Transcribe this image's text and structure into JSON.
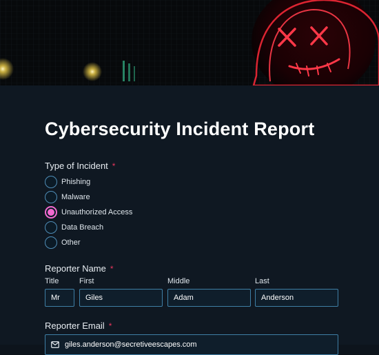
{
  "form": {
    "title": "Cybersecurity Incident Report",
    "required_mark": "*",
    "incident_type": {
      "label": "Type of Incident",
      "options": [
        "Phishing",
        "Malware",
        "Unauthorized Access",
        "Data Breach",
        "Other"
      ],
      "selected": "Unauthorized Access"
    },
    "reporter_name": {
      "label": "Reporter Name",
      "fields": {
        "title": {
          "label": "Title",
          "value": "Mr"
        },
        "first": {
          "label": "First",
          "value": "Giles"
        },
        "middle": {
          "label": "Middle",
          "value": "Adam"
        },
        "last": {
          "label": "Last",
          "value": "Anderson"
        }
      }
    },
    "reporter_email": {
      "label": "Reporter Email",
      "value": "giles.anderson@secretiveescapes.com",
      "icon": "envelope-icon"
    }
  },
  "colors": {
    "background": "#0f1822",
    "accent": "#f26ad0",
    "required": "#e8365d",
    "input_border": "#3f7fa6"
  }
}
